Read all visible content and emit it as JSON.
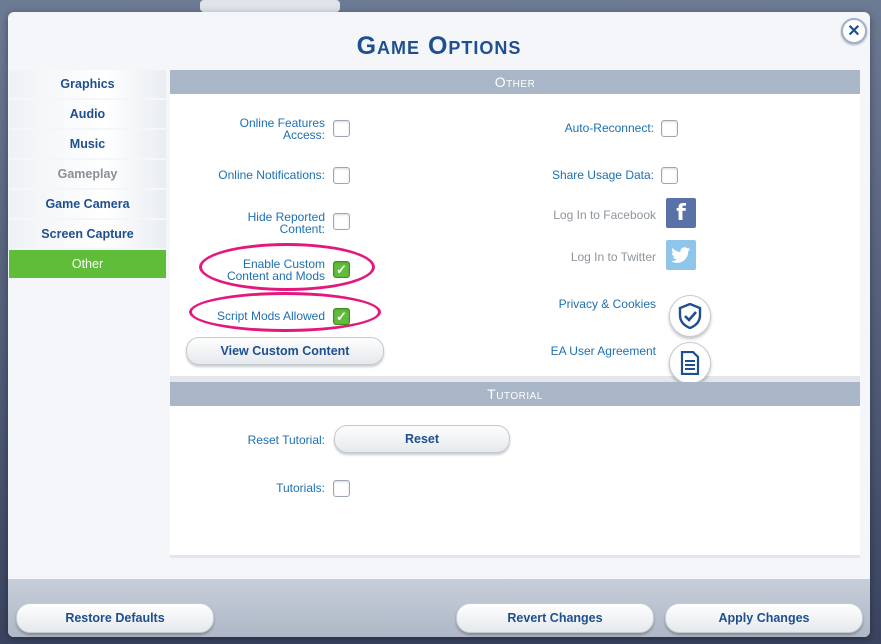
{
  "title": "Game Options",
  "close_glyph": "✕",
  "sidebar": {
    "items": [
      {
        "label": "Graphics",
        "state": "normal"
      },
      {
        "label": "Audio",
        "state": "normal"
      },
      {
        "label": "Music",
        "state": "normal"
      },
      {
        "label": "Gameplay",
        "state": "disabled"
      },
      {
        "label": "Game Camera",
        "state": "normal"
      },
      {
        "label": "Screen Capture",
        "state": "normal"
      },
      {
        "label": "Other",
        "state": "active"
      }
    ]
  },
  "other_section": {
    "header": "Other",
    "left": {
      "online_features": {
        "label_line1": "Online Features",
        "label_line2": "Access:",
        "checked": false
      },
      "online_notifications": {
        "label": "Online Notifications:",
        "checked": false
      },
      "hide_reported": {
        "label_line1": "Hide Reported",
        "label_line2": "Content:",
        "checked": false
      },
      "enable_custom": {
        "label_line1": "Enable Custom",
        "label_line2": "Content and Mods",
        "checked": true
      },
      "script_mods": {
        "label": "Script Mods Allowed",
        "checked": true
      },
      "view_custom_button": "View Custom Content"
    },
    "right": {
      "auto_reconnect": {
        "label": "Auto-Reconnect:",
        "checked": false
      },
      "share_usage": {
        "label": "Share Usage Data:",
        "checked": false
      },
      "facebook": {
        "label": "Log In to Facebook",
        "icon": "facebook-icon"
      },
      "twitter": {
        "label": "Log In to Twitter",
        "icon": "twitter-icon"
      },
      "privacy": {
        "label": "Privacy & Cookies",
        "icon": "shield-check-icon"
      },
      "ea_agreement": {
        "label": "EA User Agreement",
        "icon": "document-icon"
      }
    }
  },
  "tutorial_section": {
    "header": "Tutorial",
    "reset_tutorial_label": "Reset Tutorial:",
    "reset_button": "Reset",
    "tutorials_label": "Tutorials:",
    "tutorials_checked": false
  },
  "footer": {
    "restore_defaults": "Restore Defaults",
    "revert_changes": "Revert Changes",
    "apply_changes": "Apply Changes"
  },
  "check_glyph": "✓",
  "colors": {
    "accent_green": "#5fbd3a",
    "title_blue": "#1d4f91",
    "highlight_pink": "#e4177d",
    "facebook_blue": "#3b5998",
    "twitter_blue": "#8ec5ea"
  }
}
